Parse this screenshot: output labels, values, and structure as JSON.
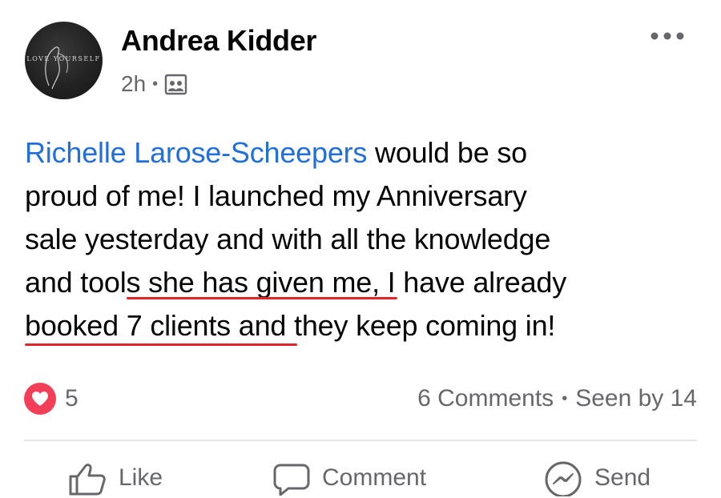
{
  "post": {
    "author": "Andrea Kidder",
    "avatar_text": "LOVE YOURSELF",
    "timestamp": "2h",
    "meta_separator": "•",
    "audience_icon": "group-audience-icon",
    "more_icon": "more-options-icon",
    "mention": "Richelle Larose-Scheepers",
    "text_lines": [
      " would be so",
      "proud of me! I launched my Anniversary",
      "sale yesterday and with all the knowledge",
      "and tools she has given me, I have already",
      "booked 7 clients and they keep coming in!"
    ]
  },
  "reactions": {
    "icon": "love-reaction-icon",
    "count": "5",
    "comments": "6 Comments",
    "separator": "•",
    "seen_by": "Seen by 14"
  },
  "actions": {
    "like": "Like",
    "comment": "Comment",
    "send": "Send"
  },
  "colors": {
    "link": "#216fdb",
    "love": "#f33e58",
    "secondary_text": "#65676b",
    "underline": "#e0262c"
  }
}
